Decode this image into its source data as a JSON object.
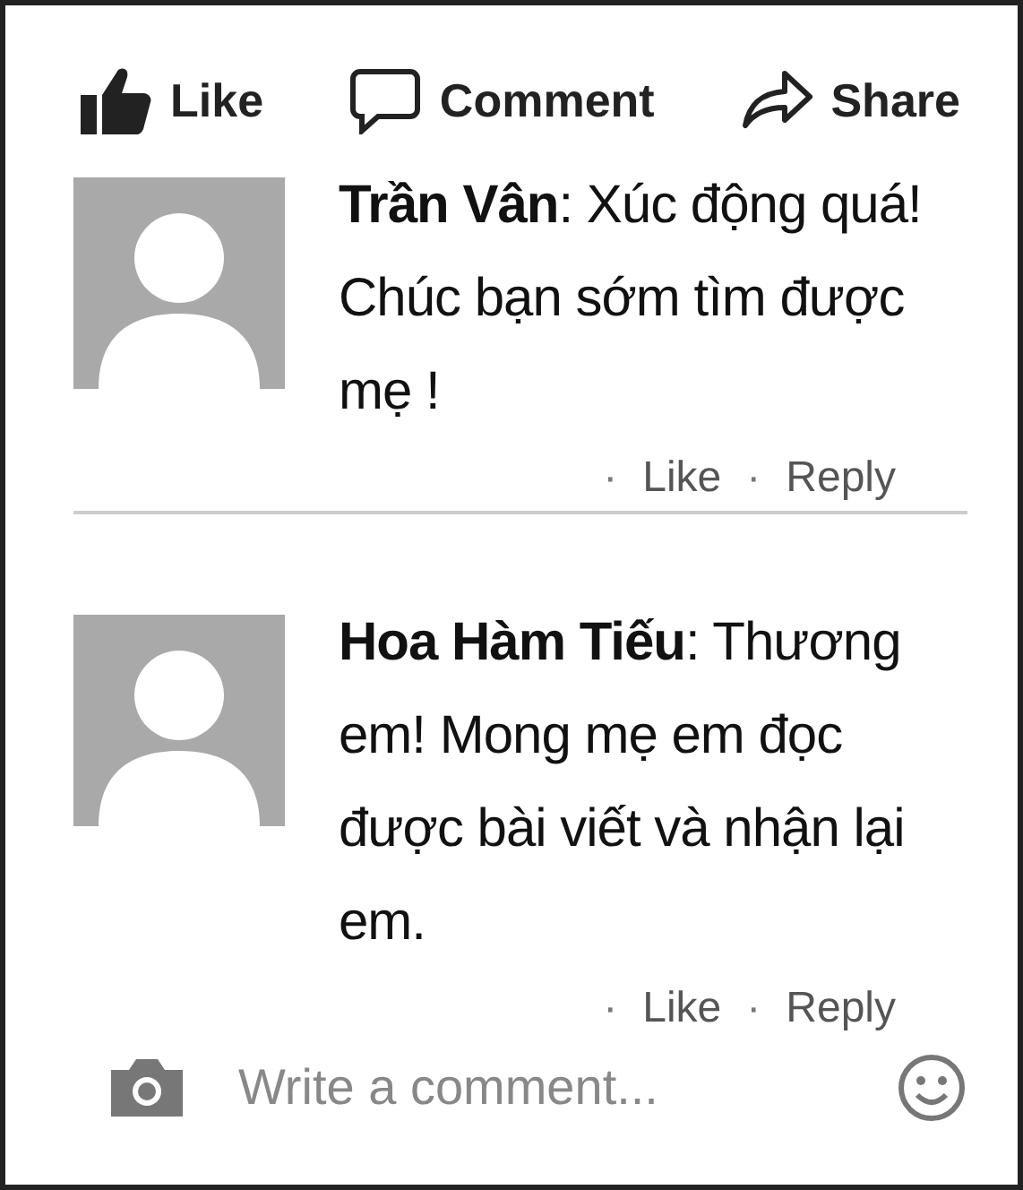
{
  "actions": [
    {
      "kind": "like",
      "label": "Like"
    },
    {
      "kind": "comment",
      "label": "Comment"
    },
    {
      "kind": "share",
      "label": "Share"
    }
  ],
  "comments": [
    {
      "text": "**Trần Vân**: Xúc động quá! Chúc bạn sớm tìm được mẹ !",
      "links": [
        {
          "dot": "·",
          "label": "Like"
        },
        {
          "dot": "·",
          "label": "Reply"
        }
      ]
    },
    {
      "text": "**Hoa Hàm Tiếu**: Thương em! Mong mẹ em đọc được bài viết và nhận lại em.",
      "links": [
        {
          "dot": "·",
          "label": "Like"
        },
        {
          "dot": "·",
          "label": "Reply"
        }
      ]
    }
  ],
  "composer": {
    "placeholder": "Write a comment..."
  }
}
